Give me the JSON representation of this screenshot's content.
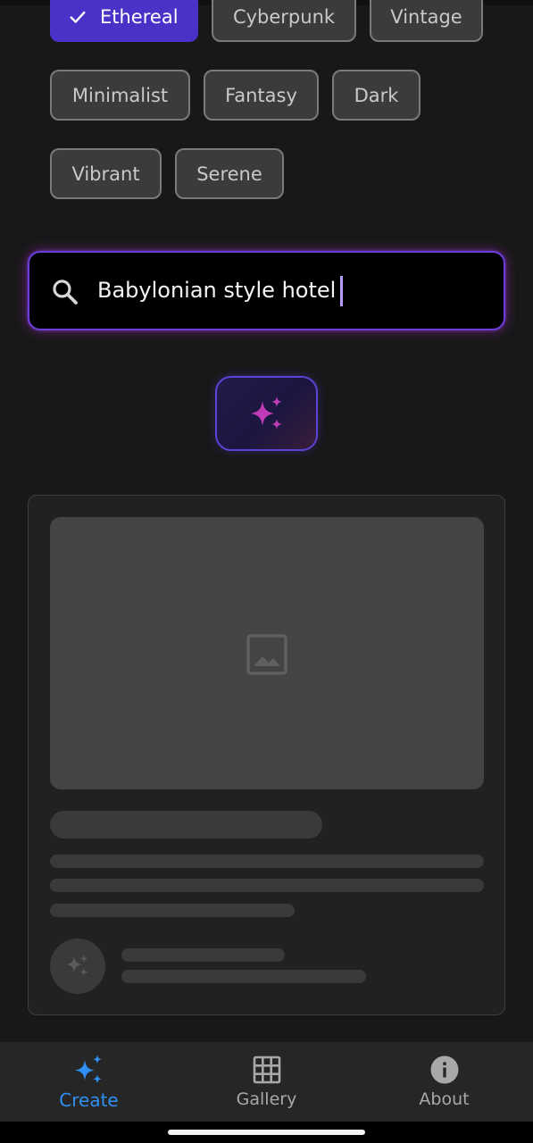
{
  "styles": {
    "chips": [
      {
        "label": "Ethereal",
        "selected": true
      },
      {
        "label": "Cyberpunk",
        "selected": false
      },
      {
        "label": "Vintage",
        "selected": false
      },
      {
        "label": "Minimalist",
        "selected": false
      },
      {
        "label": "Fantasy",
        "selected": false
      },
      {
        "label": "Dark",
        "selected": false
      },
      {
        "label": "Vibrant",
        "selected": false
      },
      {
        "label": "Serene",
        "selected": false
      }
    ]
  },
  "search": {
    "value": "Babylonian style hotel",
    "icon": "search-icon"
  },
  "generate_button": {
    "icon": "sparkles-icon"
  },
  "result_card": {
    "state": "loading-skeleton",
    "image_icon": "image-placeholder-icon",
    "avatar_icon": "sparkles-icon"
  },
  "bottom_nav": {
    "items": [
      {
        "label": "Create",
        "icon": "sparkles-icon",
        "active": true
      },
      {
        "label": "Gallery",
        "icon": "grid-icon",
        "active": false
      },
      {
        "label": "About",
        "icon": "info-icon",
        "active": false
      }
    ]
  },
  "colors": {
    "background": "#181818",
    "selected_chip": "#4b31c8",
    "accent_blue": "#2f8ff2",
    "sparkle_magenta": "#c03bb8",
    "search_glow": "#6a3fd9"
  }
}
